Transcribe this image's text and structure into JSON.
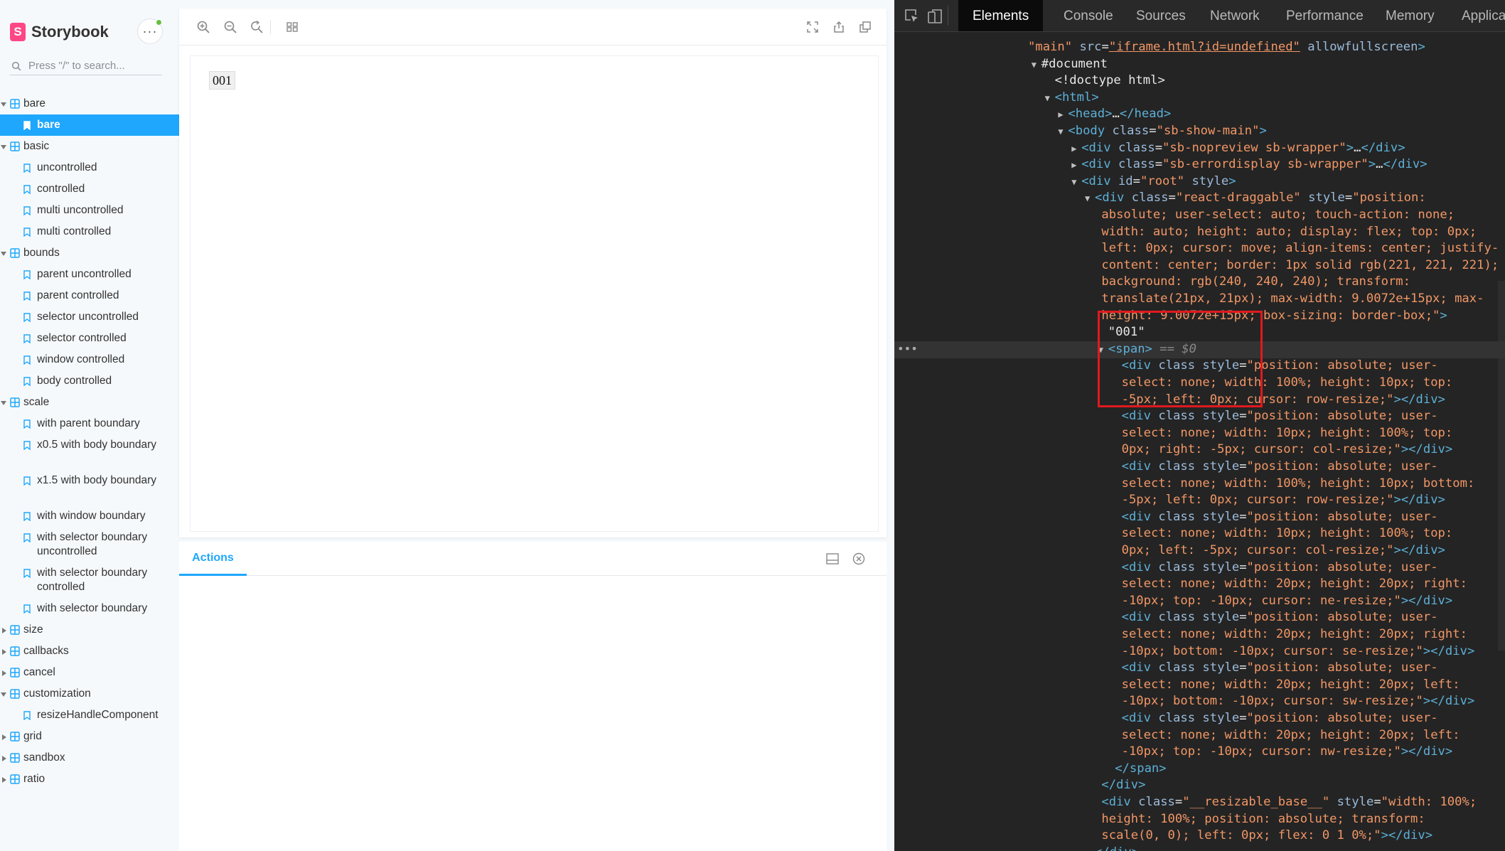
{
  "sidebar": {
    "brand": "Storybook",
    "brand_logo_letter": "S",
    "menu_label": "···",
    "search_placeholder": "Press \"/\" to search...",
    "items": [
      {
        "kind": "component",
        "label": "bare",
        "open": true
      },
      {
        "kind": "story",
        "label": "bare",
        "selected": true
      },
      {
        "kind": "component",
        "label": "basic",
        "open": true
      },
      {
        "kind": "story",
        "label": "uncontrolled"
      },
      {
        "kind": "story",
        "label": "controlled"
      },
      {
        "kind": "story",
        "label": "multi uncontrolled"
      },
      {
        "kind": "story",
        "label": "multi controlled"
      },
      {
        "kind": "component",
        "label": "bounds",
        "open": true
      },
      {
        "kind": "story",
        "label": "parent uncontrolled"
      },
      {
        "kind": "story",
        "label": "parent controlled"
      },
      {
        "kind": "story",
        "label": "selector uncontrolled"
      },
      {
        "kind": "story",
        "label": "selector controlled"
      },
      {
        "kind": "story",
        "label": "window controlled"
      },
      {
        "kind": "story",
        "label": "body controlled"
      },
      {
        "kind": "component",
        "label": "scale",
        "open": true
      },
      {
        "kind": "story",
        "label": "with parent boundary"
      },
      {
        "kind": "story",
        "label": "x0.5 with body boundary"
      },
      {
        "kind": "story",
        "label": "x1.5 with body boundary"
      },
      {
        "kind": "story",
        "label": "with window boundary"
      },
      {
        "kind": "story",
        "label": "with selector boundary uncontrolled"
      },
      {
        "kind": "story",
        "label": "with selector boundary controlled"
      },
      {
        "kind": "story",
        "label": "with selector boundary"
      },
      {
        "kind": "component",
        "label": "size",
        "open": false
      },
      {
        "kind": "component",
        "label": "callbacks",
        "open": false
      },
      {
        "kind": "component",
        "label": "cancel",
        "open": false
      },
      {
        "kind": "component",
        "label": "customization",
        "open": true
      },
      {
        "kind": "story",
        "label": "resizeHandleComponent"
      },
      {
        "kind": "component",
        "label": "grid",
        "open": false
      },
      {
        "kind": "component",
        "label": "sandbox",
        "open": false
      },
      {
        "kind": "component",
        "label": "ratio",
        "open": false
      }
    ]
  },
  "preview": {
    "content_text": "001"
  },
  "panel": {
    "tab_actions": "Actions"
  },
  "devtools": {
    "tabs": [
      "Elements",
      "Console",
      "Sources",
      "Network",
      "Performance",
      "Memory",
      "Applica"
    ],
    "active_tab": "Elements",
    "lines": [
      {
        "indent": 0,
        "tri": "",
        "parts": [
          [
            "av",
            "\"main\""
          ],
          [
            "an",
            " src"
          ],
          [
            "tx",
            "="
          ],
          [
            "lnk",
            "\"iframe.html?id=undefined\""
          ],
          [
            "an",
            " allowfullscreen"
          ],
          [
            "tag",
            ">"
          ]
        ]
      },
      {
        "indent": 1,
        "tri": "open",
        "parts": [
          [
            "tx",
            "#document"
          ]
        ]
      },
      {
        "indent": 2,
        "tri": "",
        "parts": [
          [
            "tx",
            "<!doctype html>"
          ]
        ]
      },
      {
        "indent": 2,
        "tri": "open",
        "parts": [
          [
            "tag",
            "<html>"
          ]
        ]
      },
      {
        "indent": 3,
        "tri": "closed",
        "parts": [
          [
            "tag",
            "<head>"
          ],
          [
            "tx",
            "…"
          ],
          [
            "tag",
            "</head>"
          ]
        ]
      },
      {
        "indent": 3,
        "tri": "open",
        "parts": [
          [
            "tag",
            "<body"
          ],
          [
            "an",
            " class"
          ],
          [
            "tx",
            "="
          ],
          [
            "av",
            "\"sb-show-main\""
          ],
          [
            "tag",
            ">"
          ]
        ]
      },
      {
        "indent": 4,
        "tri": "closed",
        "parts": [
          [
            "tag",
            "<div"
          ],
          [
            "an",
            " class"
          ],
          [
            "tx",
            "="
          ],
          [
            "av",
            "\"sb-nopreview sb-wrapper\""
          ],
          [
            "tag",
            ">"
          ],
          [
            "tx",
            "…"
          ],
          [
            "tag",
            "</div>"
          ]
        ]
      },
      {
        "indent": 4,
        "tri": "closed",
        "parts": [
          [
            "tag",
            "<div"
          ],
          [
            "an",
            " class"
          ],
          [
            "tx",
            "="
          ],
          [
            "av",
            "\"sb-errordisplay sb-wrapper\""
          ],
          [
            "tag",
            ">"
          ],
          [
            "tx",
            "…"
          ],
          [
            "tag",
            "</div>"
          ]
        ]
      },
      {
        "indent": 4,
        "tri": "open",
        "parts": [
          [
            "tag",
            "<div"
          ],
          [
            "an",
            " id"
          ],
          [
            "tx",
            "="
          ],
          [
            "av",
            "\"root\""
          ],
          [
            "an",
            " style"
          ],
          [
            "tag",
            ">"
          ]
        ]
      },
      {
        "indent": 5,
        "tri": "open",
        "parts": [
          [
            "tag",
            "<div"
          ],
          [
            "an",
            " class"
          ],
          [
            "tx",
            "="
          ],
          [
            "av",
            "\"react-draggable\""
          ],
          [
            "an",
            " style"
          ],
          [
            "tx",
            "="
          ],
          [
            "av",
            "\"position:"
          ]
        ]
      },
      {
        "indent": 5.5,
        "tri": "",
        "parts": [
          [
            "av",
            "absolute; user-select: auto; touch-action: none;"
          ]
        ]
      },
      {
        "indent": 5.5,
        "tri": "",
        "parts": [
          [
            "av",
            "width: auto; height: auto; display: flex; top: 0px;"
          ]
        ]
      },
      {
        "indent": 5.5,
        "tri": "",
        "parts": [
          [
            "av",
            "left: 0px; cursor: move; align-items: center; justify-"
          ]
        ]
      },
      {
        "indent": 5.5,
        "tri": "",
        "parts": [
          [
            "av",
            "content: center; border: 1px solid rgb(221, 221, 221);"
          ]
        ]
      },
      {
        "indent": 5.5,
        "tri": "",
        "parts": [
          [
            "av",
            "background: rgb(240, 240, 240); transform:"
          ]
        ]
      },
      {
        "indent": 5.5,
        "tri": "",
        "parts": [
          [
            "av",
            "translate(21px, 21px); max-width: 9.0072e+15px; max-"
          ]
        ]
      },
      {
        "indent": 5.5,
        "tri": "",
        "parts": [
          [
            "av",
            "height: 9.0072e+15px; box-sizing: border-box;\""
          ],
          [
            "tag",
            ">"
          ]
        ]
      },
      {
        "indent": 6,
        "tri": "",
        "parts": [
          [
            "tx",
            "\"001\""
          ]
        ]
      },
      {
        "indent": 6,
        "tri": "open",
        "selected": true,
        "parts": [
          [
            "tag",
            "<span>"
          ],
          [
            "dim",
            " == $0"
          ]
        ]
      },
      {
        "indent": 7,
        "tri": "",
        "parts": [
          [
            "tag",
            "<div"
          ],
          [
            "an",
            " class style"
          ],
          [
            "tx",
            "="
          ],
          [
            "av",
            "\"position: absolute; user-"
          ]
        ]
      },
      {
        "indent": 7,
        "tri": "",
        "parts": [
          [
            "av",
            "select: none; width: 100%; height: 10px; top:"
          ]
        ]
      },
      {
        "indent": 7,
        "tri": "",
        "parts": [
          [
            "av",
            "-5px; left: 0px; cursor: row-resize;\""
          ],
          [
            "tag",
            "></div>"
          ]
        ]
      },
      {
        "indent": 7,
        "tri": "",
        "parts": [
          [
            "tag",
            "<div"
          ],
          [
            "an",
            " class style"
          ],
          [
            "tx",
            "="
          ],
          [
            "av",
            "\"position: absolute; user-"
          ]
        ]
      },
      {
        "indent": 7,
        "tri": "",
        "parts": [
          [
            "av",
            "select: none; width: 10px; height: 100%; top:"
          ]
        ]
      },
      {
        "indent": 7,
        "tri": "",
        "parts": [
          [
            "av",
            "0px; right: -5px; cursor: col-resize;\""
          ],
          [
            "tag",
            "></div>"
          ]
        ]
      },
      {
        "indent": 7,
        "tri": "",
        "parts": [
          [
            "tag",
            "<div"
          ],
          [
            "an",
            " class style"
          ],
          [
            "tx",
            "="
          ],
          [
            "av",
            "\"position: absolute; user-"
          ]
        ]
      },
      {
        "indent": 7,
        "tri": "",
        "parts": [
          [
            "av",
            "select: none; width: 100%; height: 10px; bottom:"
          ]
        ]
      },
      {
        "indent": 7,
        "tri": "",
        "parts": [
          [
            "av",
            "-5px; left: 0px; cursor: row-resize;\""
          ],
          [
            "tag",
            "></div>"
          ]
        ]
      },
      {
        "indent": 7,
        "tri": "",
        "parts": [
          [
            "tag",
            "<div"
          ],
          [
            "an",
            " class style"
          ],
          [
            "tx",
            "="
          ],
          [
            "av",
            "\"position: absolute; user-"
          ]
        ]
      },
      {
        "indent": 7,
        "tri": "",
        "parts": [
          [
            "av",
            "select: none; width: 10px; height: 100%; top:"
          ]
        ]
      },
      {
        "indent": 7,
        "tri": "",
        "parts": [
          [
            "av",
            "0px; left: -5px; cursor: col-resize;\""
          ],
          [
            "tag",
            "></div>"
          ]
        ]
      },
      {
        "indent": 7,
        "tri": "",
        "parts": [
          [
            "tag",
            "<div"
          ],
          [
            "an",
            " class style"
          ],
          [
            "tx",
            "="
          ],
          [
            "av",
            "\"position: absolute; user-"
          ]
        ]
      },
      {
        "indent": 7,
        "tri": "",
        "parts": [
          [
            "av",
            "select: none; width: 20px; height: 20px; right:"
          ]
        ]
      },
      {
        "indent": 7,
        "tri": "",
        "parts": [
          [
            "av",
            "-10px; top: -10px; cursor: ne-resize;\""
          ],
          [
            "tag",
            "></div>"
          ]
        ]
      },
      {
        "indent": 7,
        "tri": "",
        "parts": [
          [
            "tag",
            "<div"
          ],
          [
            "an",
            " class style"
          ],
          [
            "tx",
            "="
          ],
          [
            "av",
            "\"position: absolute; user-"
          ]
        ]
      },
      {
        "indent": 7,
        "tri": "",
        "parts": [
          [
            "av",
            "select: none; width: 20px; height: 20px; right:"
          ]
        ]
      },
      {
        "indent": 7,
        "tri": "",
        "parts": [
          [
            "av",
            "-10px; bottom: -10px; cursor: se-resize;\""
          ],
          [
            "tag",
            "></div>"
          ]
        ]
      },
      {
        "indent": 7,
        "tri": "",
        "parts": [
          [
            "tag",
            "<div"
          ],
          [
            "an",
            " class style"
          ],
          [
            "tx",
            "="
          ],
          [
            "av",
            "\"position: absolute; user-"
          ]
        ]
      },
      {
        "indent": 7,
        "tri": "",
        "parts": [
          [
            "av",
            "select: none; width: 20px; height: 20px; left:"
          ]
        ]
      },
      {
        "indent": 7,
        "tri": "",
        "parts": [
          [
            "av",
            "-10px; bottom: -10px; cursor: sw-resize;\""
          ],
          [
            "tag",
            "></div>"
          ]
        ]
      },
      {
        "indent": 7,
        "tri": "",
        "parts": [
          [
            "tag",
            "<div"
          ],
          [
            "an",
            " class style"
          ],
          [
            "tx",
            "="
          ],
          [
            "av",
            "\"position: absolute; user-"
          ]
        ]
      },
      {
        "indent": 7,
        "tri": "",
        "parts": [
          [
            "av",
            "select: none; width: 20px; height: 20px; left:"
          ]
        ]
      },
      {
        "indent": 7,
        "tri": "",
        "parts": [
          [
            "av",
            "-10px; top: -10px; cursor: nw-resize;\""
          ],
          [
            "tag",
            "></div>"
          ]
        ]
      },
      {
        "indent": 6.5,
        "tri": "",
        "parts": [
          [
            "tag",
            "</span>"
          ]
        ]
      },
      {
        "indent": 5.5,
        "tri": "",
        "parts": [
          [
            "tag",
            "</div>"
          ]
        ]
      },
      {
        "indent": 5.5,
        "tri": "",
        "parts": [
          [
            "tag",
            "<div"
          ],
          [
            "an",
            " class"
          ],
          [
            "tx",
            "="
          ],
          [
            "av",
            "\"__resizable_base__\""
          ],
          [
            "an",
            " style"
          ],
          [
            "tx",
            "="
          ],
          [
            "av",
            "\"width: 100%;"
          ]
        ]
      },
      {
        "indent": 5.5,
        "tri": "",
        "parts": [
          [
            "av",
            "height: 100%; position: absolute; transform:"
          ]
        ]
      },
      {
        "indent": 5.5,
        "tri": "",
        "parts": [
          [
            "av",
            "scale(0, 0); left: 0px; flex: 0 1 0%;\""
          ],
          [
            "tag",
            "></div>"
          ]
        ]
      },
      {
        "indent": 5,
        "tri": "",
        "parts": [
          [
            "tag",
            "</div>"
          ]
        ]
      }
    ]
  },
  "colors": {
    "accent": "#1ea7fd",
    "brand": "#ff4785",
    "status_online": "#66bf3c",
    "highlight_box": "#e0191e"
  }
}
